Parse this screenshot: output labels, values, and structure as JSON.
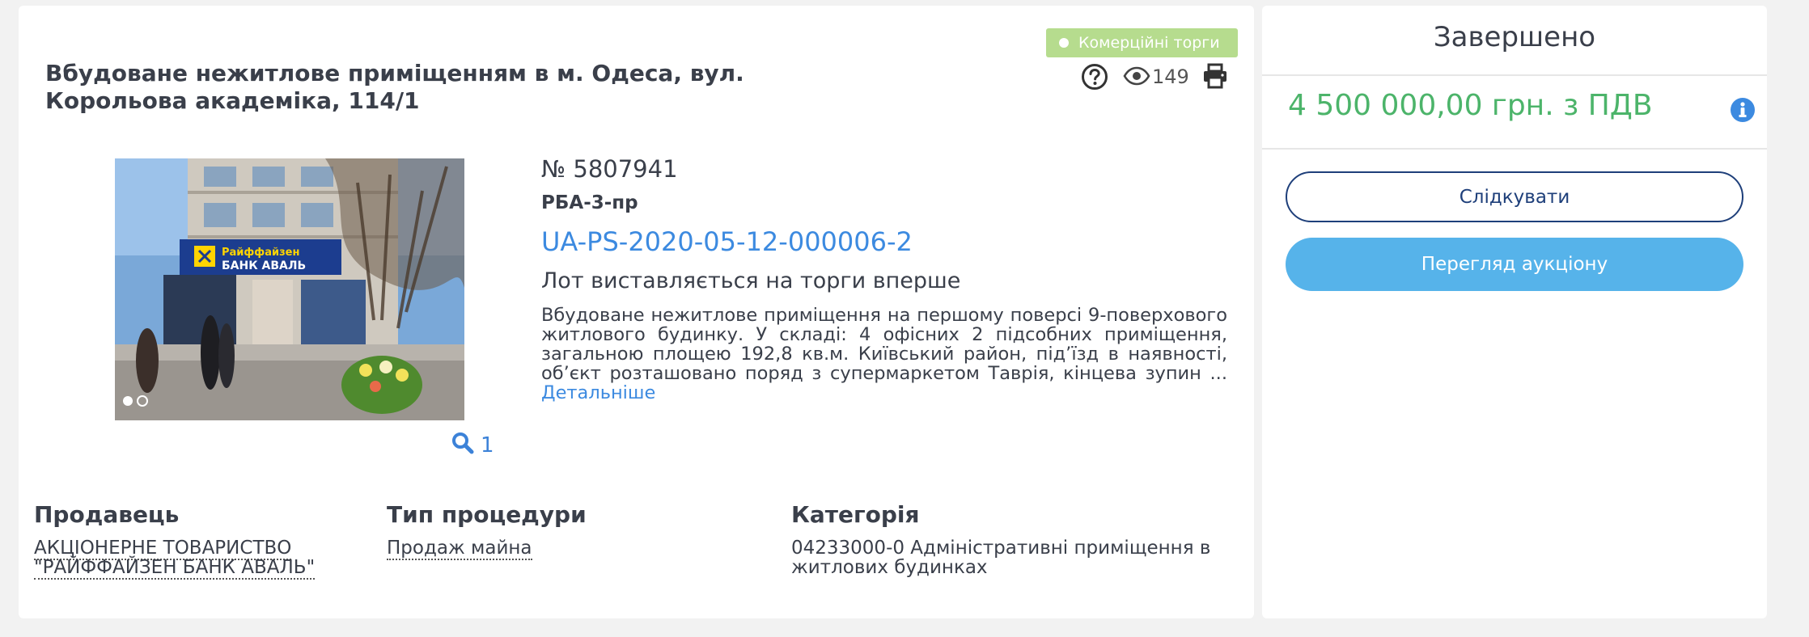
{
  "lot": {
    "badge": "Комерційні торги",
    "title": "Вбудоване нежитлове приміщенням в м. Одеса, вул. Корольова академіка, 114/1",
    "views": "149",
    "number": "№ 5807941",
    "code": "РБА-3-пр",
    "auction_id": "UA-PS-2020-05-12-000006-2",
    "first_offer": "Лот виставляється на торги вперше",
    "description": "Вбудоване нежитлове приміщення на першому поверсі 9-поверхового житлового будинку. У складі: 4 офісних 2 підсобних приміщення, загальною площею 192,8 кв.м. Київський район, під’їзд в наявності, об’єкт розташовано поряд з супермаркетом Таврія, кінцева зупин ...",
    "details_link": "Детальніше",
    "photo_count": "1",
    "photo_sign": "РАЙФФАЙЗЕН БАНК АВАЛЬ"
  },
  "info": {
    "seller_label": "Продавець",
    "seller_value": "АКЦІОНЕРНЕ ТОВАРИСТВО \"РАЙФФАЙЗЕН БАНК АВАЛЬ\"",
    "procedure_label": "Тип процедури",
    "procedure_value": "Продаж майна",
    "category_label": "Категорія",
    "category_value": "04233000-0 Адміністративні приміщення в житлових будинках"
  },
  "sidebar": {
    "status": "Завершено",
    "price": "4 500 000,00 грн. з ПДВ",
    "follow_label": "Слідкувати",
    "view_label": "Перегляд аукціону"
  },
  "colors": {
    "accent_blue": "#3c8ae0",
    "price_green": "#4cb46a",
    "badge_green": "#b6dc8e",
    "button_blue": "#56b3ea",
    "navy": "#1e3f7a"
  },
  "icons": [
    "help-icon",
    "eye-icon",
    "print-icon",
    "search-icon",
    "info-icon"
  ]
}
